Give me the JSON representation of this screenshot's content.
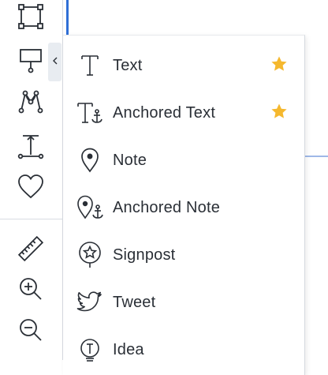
{
  "toolbar": {
    "tools": [
      {
        "name": "rectangle-tool",
        "icon": "rectangle-icon"
      },
      {
        "name": "signpost-shape-tool",
        "icon": "pin-sign-icon"
      },
      {
        "name": "freehand-path-tool",
        "icon": "path-nodes-icon"
      },
      {
        "name": "connector-tool",
        "icon": "connector-icon"
      },
      {
        "name": "heart-tool",
        "icon": "heart-icon"
      },
      {
        "name": "ruler-tool",
        "icon": "ruler-icon"
      },
      {
        "name": "zoom-in-tool",
        "icon": "zoom-in-icon"
      },
      {
        "name": "zoom-out-tool",
        "icon": "zoom-out-icon"
      }
    ],
    "expander_icon": "chevron-left-icon"
  },
  "menu": {
    "items": [
      {
        "label": "Text",
        "icon": "text-icon",
        "starred": true
      },
      {
        "label": "Anchored Text",
        "icon": "anchored-text-icon",
        "starred": true
      },
      {
        "label": "Note",
        "icon": "location-pin-icon",
        "starred": false
      },
      {
        "label": "Anchored Note",
        "icon": "anchored-note-icon",
        "starred": false
      },
      {
        "label": "Signpost",
        "icon": "star-pin-icon",
        "starred": false
      },
      {
        "label": "Tweet",
        "icon": "bird-icon",
        "starred": false
      },
      {
        "label": "Idea",
        "icon": "lightbulb-icon",
        "starred": false
      }
    ]
  },
  "colors": {
    "icon_stroke": "#2a2f36",
    "star": "#f5b82e",
    "accent": "#2f6fd6",
    "expander_bg": "#e8ecf1"
  }
}
